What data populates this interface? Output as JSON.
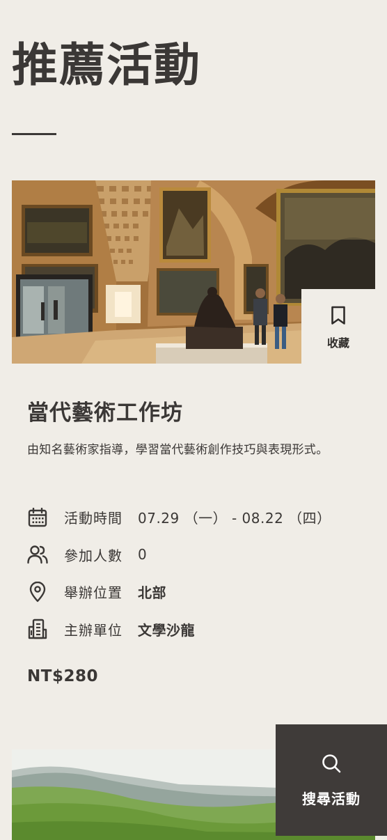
{
  "page": {
    "title": "推薦活動"
  },
  "card": {
    "image_alt": "museum gallery with paintings and sculpture",
    "bookmark_label": "收藏",
    "title": "當代藝術工作坊",
    "description": "由知名藝術家指導，學習當代藝術創作技巧與表現形式。",
    "info": [
      {
        "icon": "calendar-icon",
        "label": "活動時間",
        "value": "07.29 （一） - 08.22 （四）"
      },
      {
        "icon": "people-icon",
        "label": "參加人數",
        "value": "0"
      },
      {
        "icon": "location-pin-icon",
        "label": "舉辦位置",
        "value": "北部"
      },
      {
        "icon": "building-icon",
        "label": "主辦單位",
        "value": "文學沙龍"
      }
    ],
    "price": "NT$280"
  },
  "card2": {
    "image_alt": "green mountain landscape"
  },
  "fab": {
    "label": "搜尋活動",
    "icon": "search-icon"
  },
  "colors": {
    "background": "#f0ede7",
    "text": "#3b3836",
    "fab_bg": "#3f3b39"
  }
}
